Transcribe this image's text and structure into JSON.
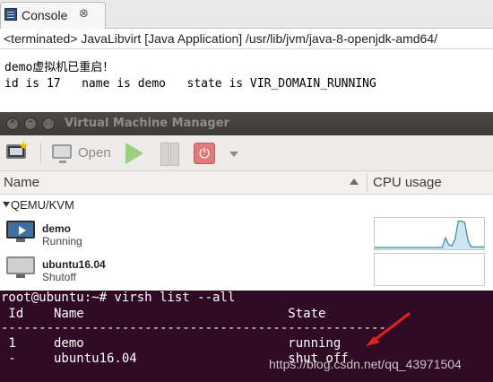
{
  "console": {
    "tab_label": "Console",
    "tab_close_glyph": "⊗",
    "status_line": "<terminated> JavaLibvirt [Java Application] /usr/lib/jvm/java-8-openjdk-amd64/",
    "output": [
      "demo虚拟机已重启！",
      "id is 17   name is demo   state is VIR_DOMAIN_RUNNING"
    ]
  },
  "vmm": {
    "title": "Virtual Machine Manager",
    "toolbar": {
      "new_icon": "new-vm-icon",
      "open_label": "Open",
      "run_icon": "play-icon",
      "pause_icon": "pause-icon",
      "shutdown_icon": "power-icon",
      "shutdown_glyph": "⏻",
      "menu_icon": "dropdown-arrow-icon"
    },
    "columns": {
      "name": "Name",
      "cpu": "CPU usage"
    },
    "connection": "QEMU/KVM",
    "vms": [
      {
        "name": "demo",
        "status": "Running",
        "cpu_trace": [
          0,
          0,
          0,
          0,
          0,
          0,
          0,
          0,
          0,
          0,
          0,
          0,
          0,
          0,
          0,
          0,
          0,
          0,
          0,
          0,
          0,
          0,
          0.35,
          0.1,
          0.05,
          0.3,
          0.95,
          0.95,
          0.9,
          0.25,
          0.02,
          0.02,
          0.02,
          0.02,
          0.02
        ]
      },
      {
        "name": "ubuntu16.04",
        "status": "Shutoff",
        "cpu_trace": []
      }
    ],
    "colors": {
      "titlebar": "#3c3b37",
      "cpu_line": "#3d8fb0",
      "cpu_fill": "#cfe6ef"
    }
  },
  "terminal": {
    "prompt_line": "root@ubuntu:~# virsh list --all",
    "header": " Id    Name                           State",
    "separator": "----------------------------------------------------",
    "rows": [
      " 1     demo                           running",
      " -     ubuntu16.04                    shut off"
    ],
    "watermark": "https://blog.csdn.net/qq_43971504",
    "colors": {
      "background": "#300a24",
      "arrow": "#e02020"
    }
  }
}
